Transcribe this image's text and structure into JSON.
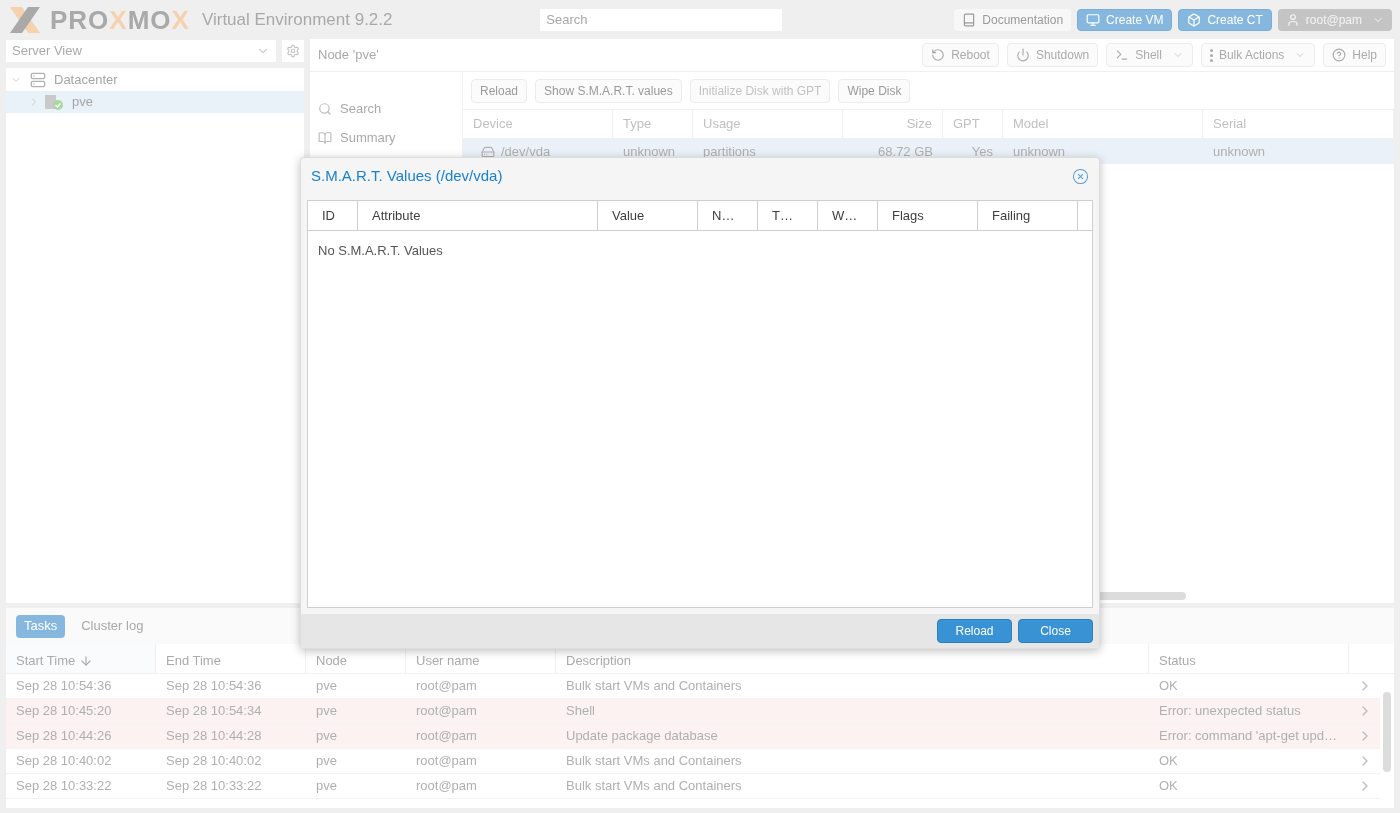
{
  "header": {
    "logo": [
      {
        "text": "PRO",
        "accent": false
      },
      {
        "text": "X",
        "accent": true
      },
      {
        "text": "MO",
        "accent": false
      },
      {
        "text": "X",
        "accent": true
      }
    ],
    "product": "Virtual Environment 9.2.2",
    "search": {
      "placeholder": "Search"
    },
    "buttons": [
      {
        "kind": "doc",
        "label": "Documentation"
      },
      {
        "kind": "vm",
        "label": "Create VM"
      },
      {
        "kind": "ct",
        "label": "Create CT"
      },
      {
        "kind": "user",
        "label": "root@pam"
      }
    ]
  },
  "sidebar": {
    "view": "Server View",
    "tree": [
      {
        "label": "Datacenter",
        "kind": "datacenter",
        "expanded": true,
        "selected": false,
        "children": [
          {
            "label": "pve",
            "kind": "node",
            "expanded": false,
            "selected": true
          }
        ]
      }
    ]
  },
  "node_panel": {
    "title": "Node 'pve'",
    "actions": [
      {
        "kind": "reboot",
        "label": "Reboot"
      },
      {
        "kind": "shutdown",
        "label": "Shutdown"
      },
      {
        "kind": "shell",
        "label": "Shell"
      },
      {
        "kind": "bulk",
        "label": "Bulk Actions"
      },
      {
        "kind": "help",
        "label": "Help"
      }
    ],
    "nav": [
      {
        "kind": "search",
        "label": "Search"
      },
      {
        "kind": "summary",
        "label": "Summary"
      }
    ],
    "toolbar": [
      {
        "label": "Reload",
        "disabled": false
      },
      {
        "label": "Show S.M.A.R.T. values",
        "disabled": false
      },
      {
        "label": "Initialize Disk with GPT",
        "disabled": true
      },
      {
        "label": "Wipe Disk",
        "disabled": false
      }
    ],
    "disks": {
      "columns": [
        "Device",
        "Type",
        "Usage",
        "Size",
        "GPT",
        "Model",
        "Serial"
      ],
      "rows": [
        {
          "selected": true,
          "cells": [
            "/dev/vda",
            "unknown",
            "partitions",
            "68.72 GB",
            "Yes",
            "unknown",
            "unknown"
          ]
        }
      ]
    }
  },
  "tasks": {
    "tabs": [
      {
        "label": "Tasks",
        "selected": true
      },
      {
        "label": "Cluster log",
        "selected": false
      }
    ],
    "columns": [
      "Start Time",
      "End Time",
      "Node",
      "User name",
      "Description",
      "Status"
    ],
    "rows": [
      {
        "error": false,
        "cells": [
          "Sep 28 10:54:36",
          "Sep 28 10:54:36",
          "pve",
          "root@pam",
          "Bulk start VMs and Containers",
          "OK"
        ]
      },
      {
        "error": true,
        "cells": [
          "Sep 28 10:45:20",
          "Sep 28 10:54:34",
          "pve",
          "root@pam",
          "Shell",
          "Error: unexpected status"
        ]
      },
      {
        "error": true,
        "cells": [
          "Sep 28 10:44:26",
          "Sep 28 10:44:28",
          "pve",
          "root@pam",
          "Update package database",
          "Error: command 'apt-get upd…"
        ]
      },
      {
        "error": false,
        "cells": [
          "Sep 28 10:40:02",
          "Sep 28 10:40:02",
          "pve",
          "root@pam",
          "Bulk start VMs and Containers",
          "OK"
        ]
      },
      {
        "error": false,
        "cells": [
          "Sep 28 10:33:22",
          "Sep 28 10:33:22",
          "pve",
          "root@pam",
          "Bulk start VMs and Containers",
          "OK"
        ]
      }
    ]
  },
  "dialog": {
    "title": "S.M.A.R.T. Values (/dev/vda)",
    "columns": [
      "ID",
      "Attribute",
      "Value",
      "N…",
      "T…",
      "W…",
      "Flags",
      "Failing"
    ],
    "empty_text": "No S.M.A.R.T. Values",
    "buttons": [
      "Reload",
      "Close"
    ]
  }
}
